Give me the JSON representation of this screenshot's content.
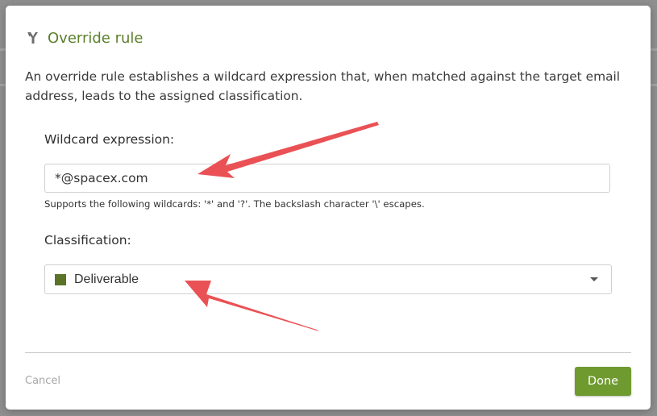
{
  "dialog": {
    "title": "Override rule",
    "title_icon": "fork-icon",
    "description": "An override rule establishes a wildcard expression that, when matched against the target email address, leads to the assigned classification."
  },
  "wildcard": {
    "label": "Wildcard expression:",
    "value": "*@spacex.com",
    "hint": "Supports the following wildcards: '*' and '?'. The backslash character '\\' escapes."
  },
  "classification": {
    "label": "Classification:",
    "selected": "Deliverable",
    "swatch_color": "#5b7329"
  },
  "footer": {
    "cancel_label": "Cancel",
    "done_label": "Done"
  },
  "colors": {
    "accent": "#5b7f2a",
    "done_button": "#6f9a2f",
    "annotation_arrow": "#ea5155"
  }
}
